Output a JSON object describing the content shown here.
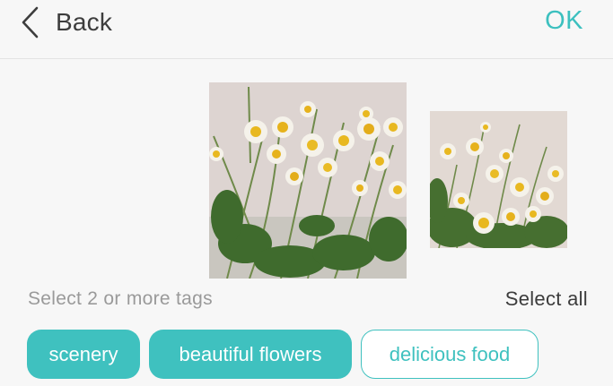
{
  "header": {
    "back_label": "Back",
    "ok_label": "OK"
  },
  "photos": [
    {
      "name": "daisies-photo-1",
      "icon": "photo-image"
    },
    {
      "name": "daisies-photo-2",
      "icon": "photo-image"
    }
  ],
  "tags_section": {
    "hint": "Select 2 or more tags",
    "select_all_label": "Select all",
    "tags": [
      {
        "label": "scenery",
        "selected": true
      },
      {
        "label": "beautiful flowers",
        "selected": true
      },
      {
        "label": "delicious food",
        "selected": false
      }
    ]
  },
  "colors": {
    "accent": "#3fc1bf",
    "text_dark": "#3d3d3d",
    "text_muted": "#9a9a9a",
    "background": "#f7f7f7"
  }
}
